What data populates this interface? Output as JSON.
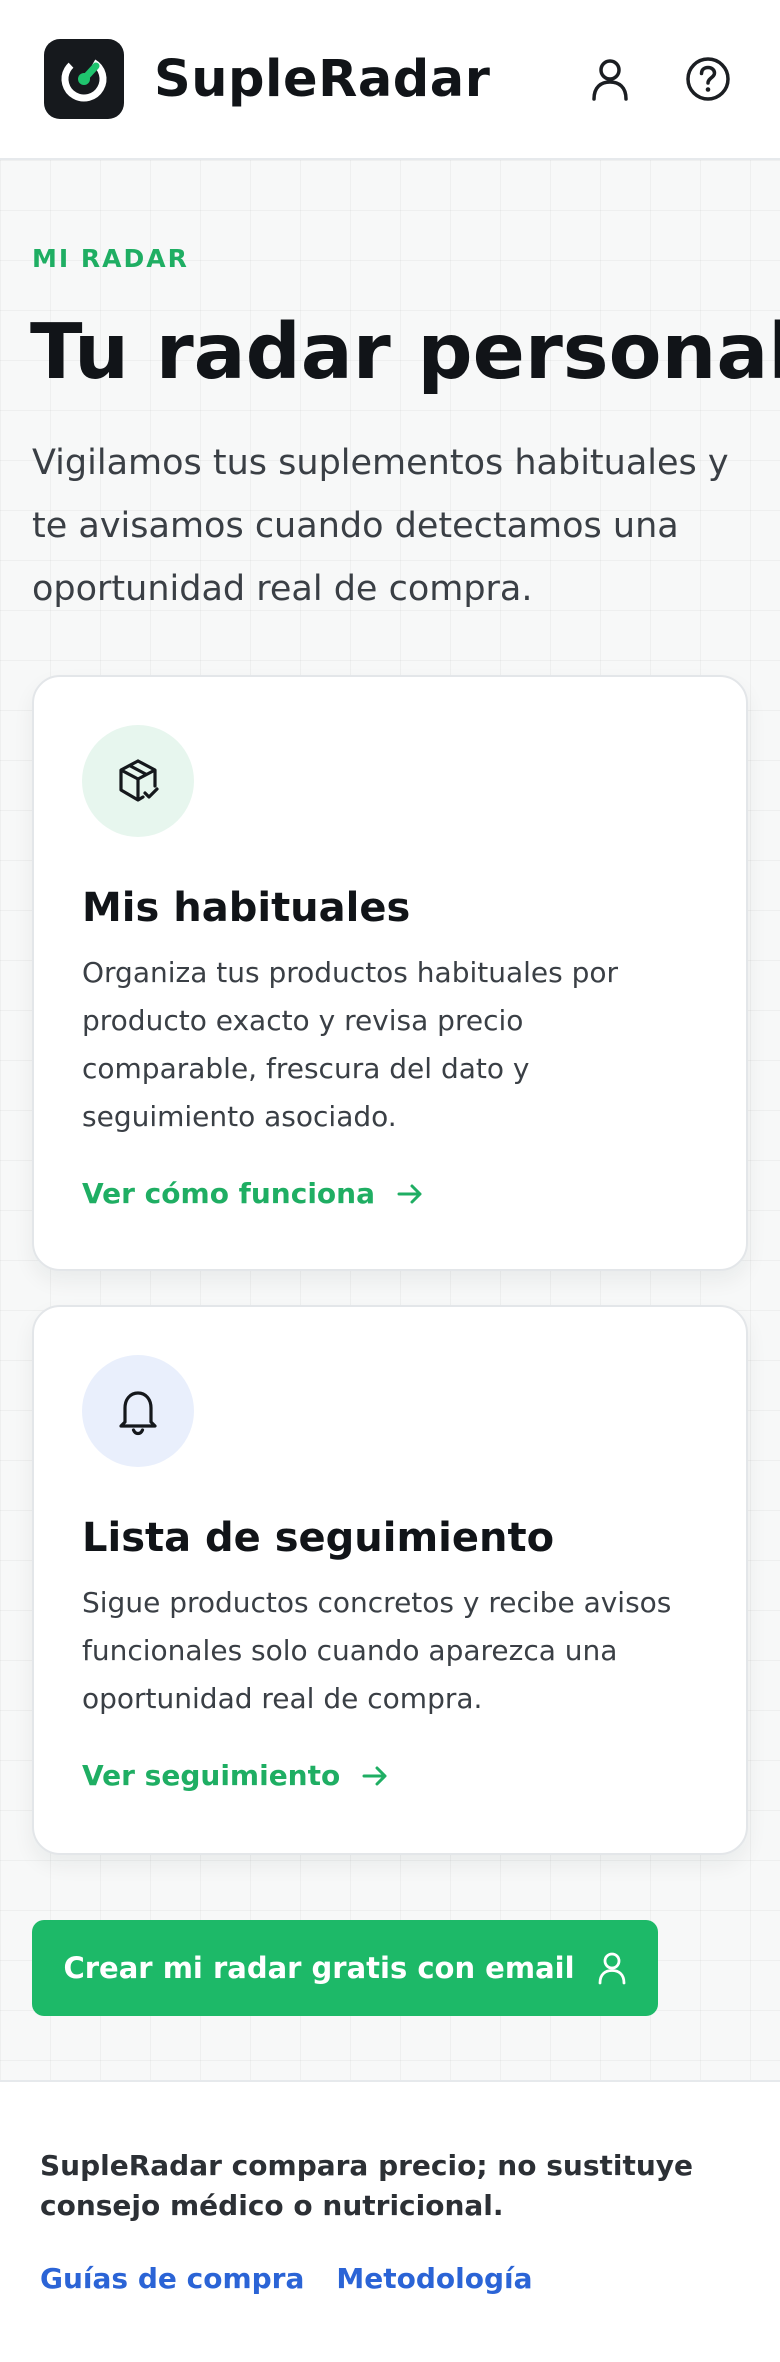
{
  "header": {
    "brand": "SupleRadar",
    "icons": [
      "radar-logo-icon",
      "user-icon",
      "help-circle-icon"
    ],
    "accent_color": "#1fae63"
  },
  "hero": {
    "eyebrow": "MI RADAR",
    "title": "Tu radar personal",
    "lead": "Vigilamos tus suplementos habituales y te avisamos cuando detectamos una oportunidad real de compra."
  },
  "cards": [
    {
      "icon": "package-check-icon",
      "title": "Mis habituales",
      "text": "Organiza tus productos habituales por producto exacto y revisa precio comparable, frescura del dato y seguimiento asociado.",
      "link": "Ver cómo funciona"
    },
    {
      "icon": "bell-icon",
      "title": "Lista de seguimiento",
      "text": "Sigue productos concretos y recibe avisos funcionales solo cuando aparezca una oportunidad real de compra.",
      "link": "Ver seguimiento"
    }
  ],
  "cta": {
    "label": "Crear mi radar gratis con email",
    "color": "#1db968"
  },
  "footer": {
    "disclaimer": "SupleRadar compara precio; no sustituye consejo médico o nutricional.",
    "links": [
      "Guías de compra",
      "Metodología"
    ],
    "link_color": "#2b64d6"
  }
}
